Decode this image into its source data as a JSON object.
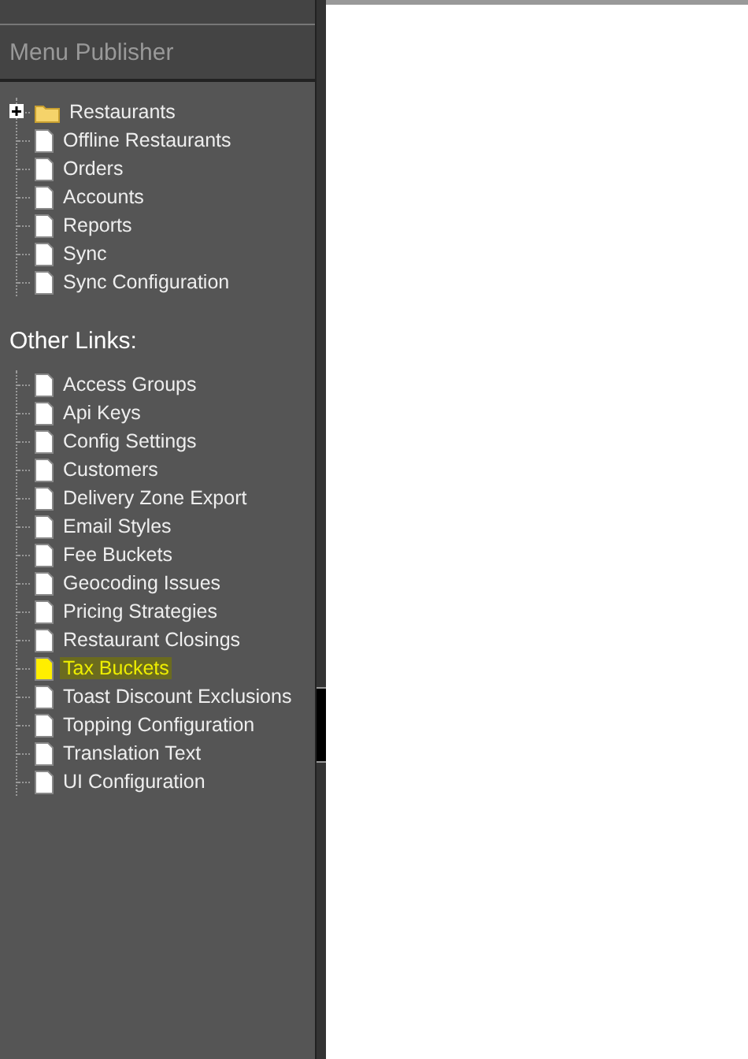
{
  "sidebar": {
    "title": "Menu Publisher",
    "tree": [
      {
        "label": "Restaurants",
        "kind": "folder",
        "expanded": false,
        "selected": false
      },
      {
        "label": "Offline Restaurants",
        "kind": "page",
        "selected": false
      },
      {
        "label": "Orders",
        "kind": "page",
        "selected": false
      },
      {
        "label": "Accounts",
        "kind": "page",
        "selected": false
      },
      {
        "label": "Reports",
        "kind": "page",
        "selected": false
      },
      {
        "label": "Sync",
        "kind": "page",
        "selected": false
      },
      {
        "label": "Sync Configuration",
        "kind": "page",
        "selected": false
      }
    ],
    "other_links": {
      "heading": "Other Links:",
      "items": [
        {
          "label": "Access Groups",
          "kind": "page",
          "selected": false
        },
        {
          "label": "Api Keys",
          "kind": "page",
          "selected": false
        },
        {
          "label": "Config Settings",
          "kind": "page",
          "selected": false
        },
        {
          "label": "Customers",
          "kind": "page",
          "selected": false
        },
        {
          "label": "Delivery Zone Export",
          "kind": "page",
          "selected": false
        },
        {
          "label": "Email Styles",
          "kind": "page",
          "selected": false
        },
        {
          "label": "Fee Buckets",
          "kind": "page",
          "selected": false
        },
        {
          "label": "Geocoding Issues",
          "kind": "page",
          "selected": false
        },
        {
          "label": "Pricing Strategies",
          "kind": "page",
          "selected": false
        },
        {
          "label": "Restaurant Closings",
          "kind": "page",
          "selected": false
        },
        {
          "label": "Tax Buckets",
          "kind": "page",
          "selected": true
        },
        {
          "label": "Toast Discount Exclusions",
          "kind": "page",
          "selected": false
        },
        {
          "label": "Topping Configuration",
          "kind": "page",
          "selected": false
        },
        {
          "label": "Translation Text",
          "kind": "page",
          "selected": false
        },
        {
          "label": "UI Configuration",
          "kind": "page",
          "selected": false
        }
      ]
    }
  }
}
